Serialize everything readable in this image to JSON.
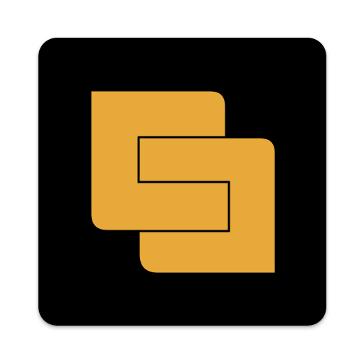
{
  "app_icon": {
    "icon": "interlocking-blocks-logo-icon",
    "background_color": "#000000",
    "shape_color": "#E7A93A",
    "outline_color": "#000000"
  }
}
